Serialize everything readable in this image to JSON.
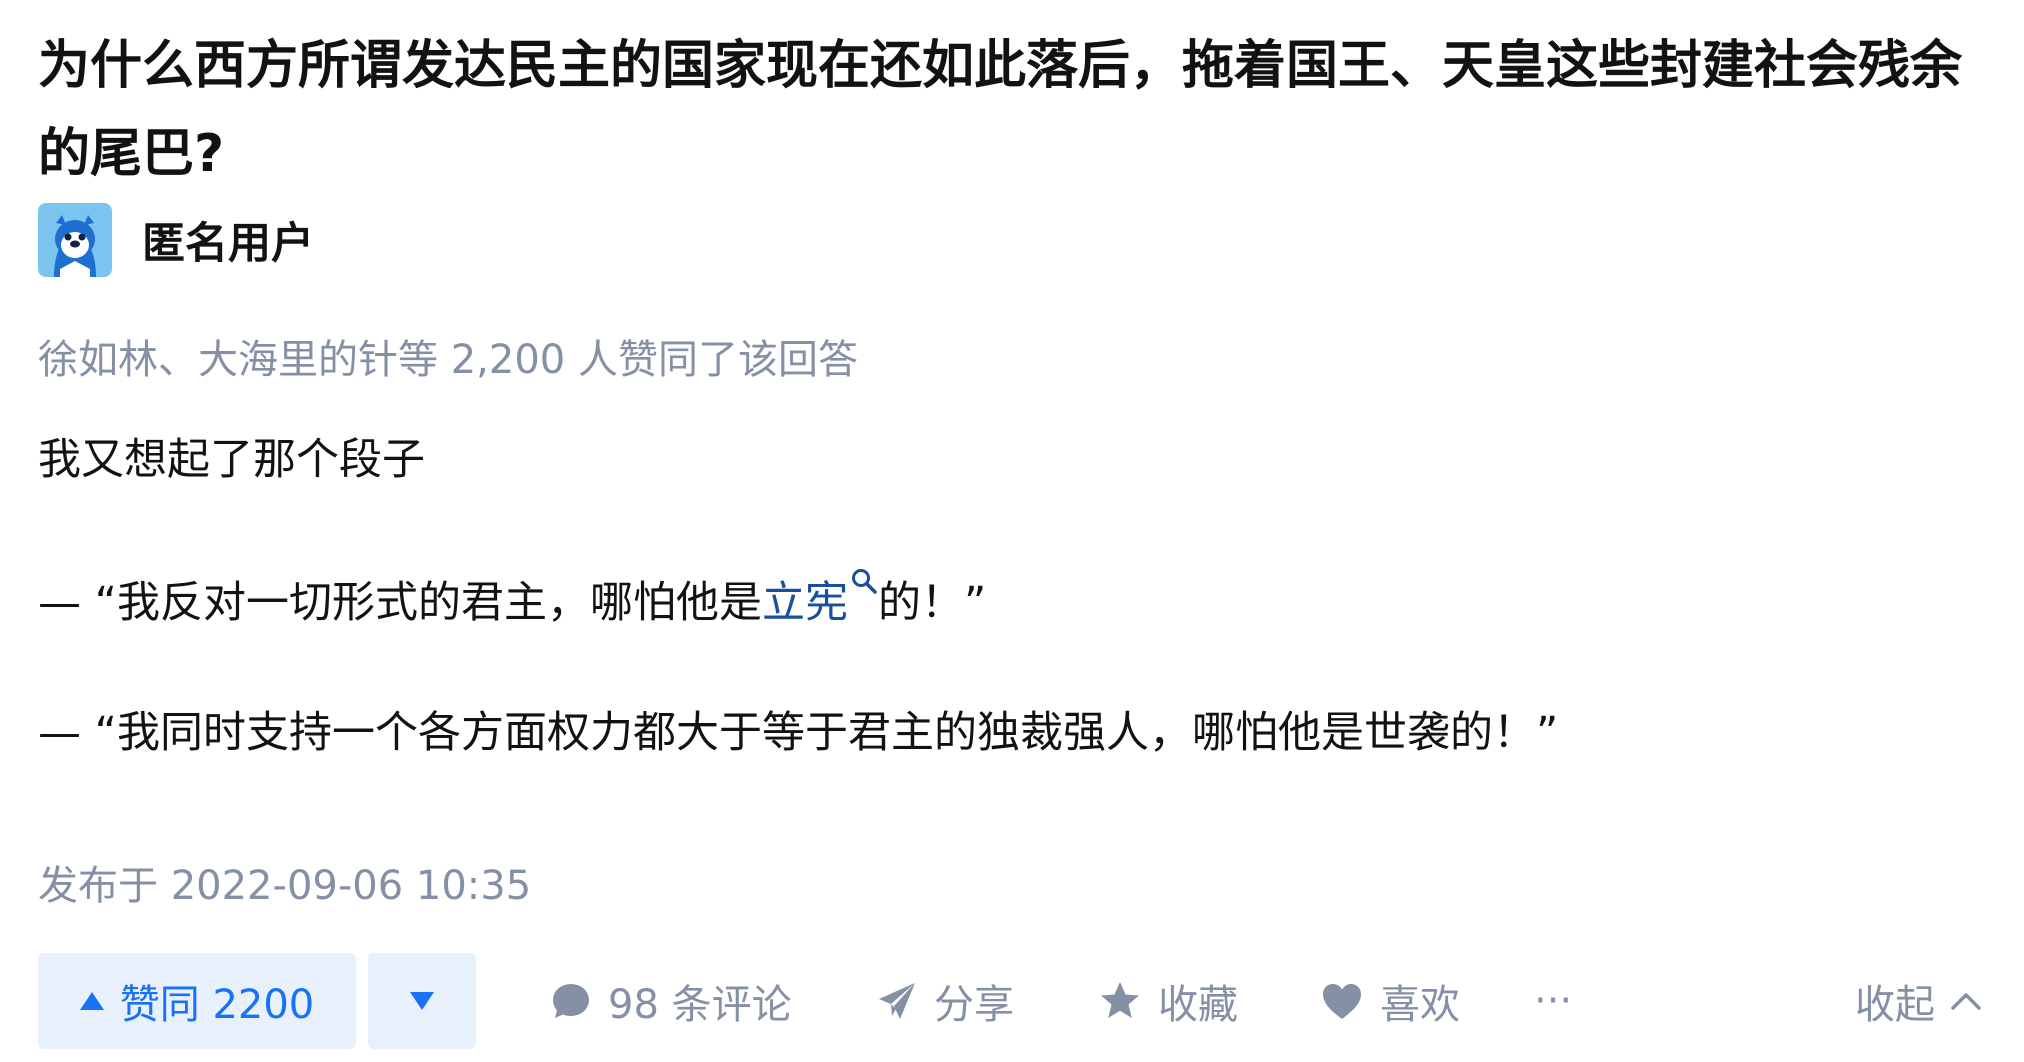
{
  "question": {
    "title": "为什么西方所谓发达民主的国家现在还如此落后，拖着国王、天皇这些封建社会残余的尾巴?"
  },
  "author": {
    "name": "匿名用户"
  },
  "answer": {
    "voters_text": "徐如林、大海里的针等 2,200 人赞同了该回答",
    "paragraph_1": "我又想起了那个段子",
    "paragraph_2_before": "— “我反对一切形式的君主，哪怕他是",
    "paragraph_2_link": "立宪",
    "paragraph_2_after": "的！”",
    "paragraph_3": "— “我同时支持一个各方面权力都大于等于君主的独裁强人，哪怕他是世袭的！”",
    "published": "发布于 2022-09-06 10:35"
  },
  "actions": {
    "upvote_label": "赞同 2200",
    "comment_label": "98 条评论",
    "share_label": "分享",
    "favorite_label": "收藏",
    "like_label": "喜欢",
    "more_label": "···",
    "collapse_label": "收起"
  },
  "icons": {
    "avatar": "anonymous-avatar-icon",
    "upvote": "triangle-up-icon",
    "downvote": "triangle-down-icon",
    "comment": "comment-bubble-icon",
    "share": "paper-plane-icon",
    "favorite": "star-icon",
    "like": "heart-icon",
    "collapse": "chevron-up-icon",
    "search": "search-icon"
  },
  "colors": {
    "accent": "#1772f6",
    "accent_bg": "#e8f0fb",
    "muted": "#8590a6",
    "link": "#175199",
    "text": "#121212"
  }
}
